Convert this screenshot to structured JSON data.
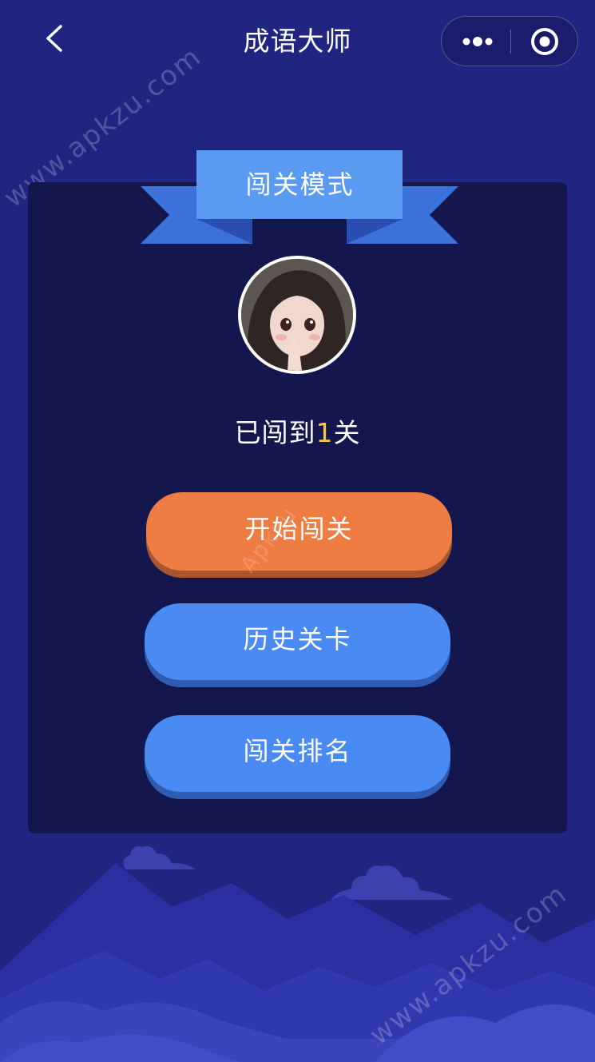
{
  "nav": {
    "title": "成语大师",
    "back_icon": "chevron-left-icon",
    "more_icon": "more-dots-icon",
    "close_icon": "target-circle-icon"
  },
  "watermarks": [
    "www.apkzu.com",
    "www.apkzu.com",
    "Apkzu"
  ],
  "card": {
    "ribbon_title": "闯关模式",
    "progress_prefix": "已闯到",
    "progress_level": "1",
    "progress_suffix": "关"
  },
  "buttons": {
    "start": "开始闯关",
    "history": "历史关卡",
    "rank": "闯关排名"
  },
  "colors": {
    "background": "#1f2580",
    "panel": "#14174e",
    "ribbon": "#5a9af2",
    "start_button": "#ee7d44",
    "secondary_button": "#4a8bf3",
    "level_highlight": "#f6c54a"
  }
}
